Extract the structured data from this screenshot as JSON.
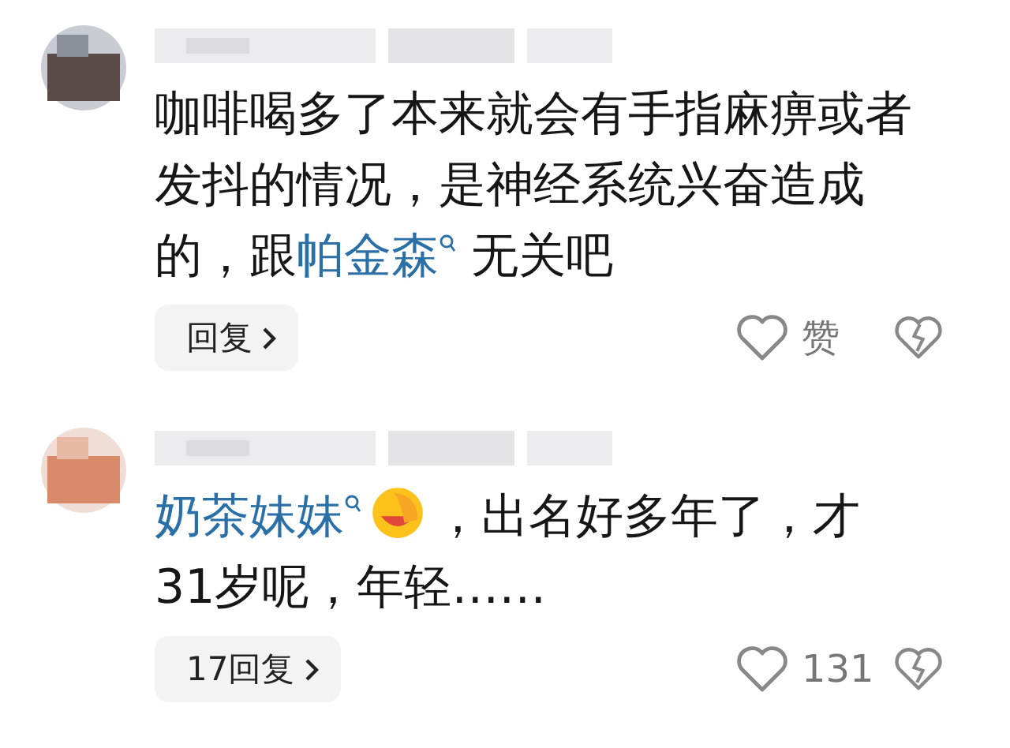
{
  "comments": [
    {
      "body": [
        {
          "kind": "text",
          "text": "咖啡喝多了本来就会有手指麻痹或者发抖的情况，是神经系统兴奋造成的，跟"
        },
        {
          "kind": "link",
          "text": "帕金森"
        },
        {
          "kind": "text",
          "text": " 无关吧"
        }
      ],
      "reply_button": "回复",
      "likes": "赞"
    },
    {
      "body": [
        {
          "kind": "link",
          "text": "奶茶妹妹"
        },
        {
          "kind": "emoji"
        },
        {
          "kind": "text",
          "text": "，出名好多年了，才31岁呢，年轻……"
        }
      ],
      "reply_button": "17回复",
      "likes": "131"
    }
  ]
}
